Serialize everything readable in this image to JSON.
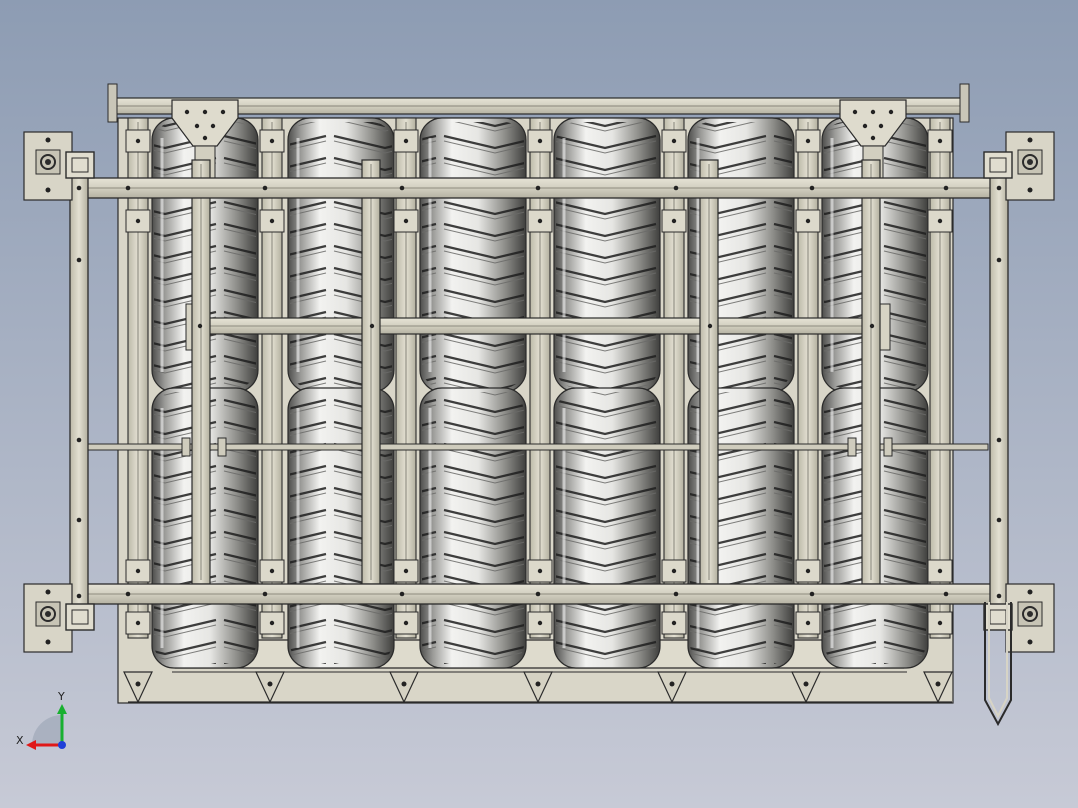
{
  "colors": {
    "background_top": "#8d9cb3",
    "background_bottom": "#c7cad6",
    "metal": "#d7d4c6",
    "metal_shade": "#b9b6a6",
    "edge": "#2b2b2b",
    "tire_light": "#eeeeec",
    "tire_dark": "#5a5a58",
    "axis_x": "#e01818",
    "axis_y": "#18b030",
    "axis_z": "#1f3fd8"
  },
  "icons": {
    "triad": "coordinate-triad-icon"
  },
  "triad": {
    "x_label": "X",
    "y_label": "Y"
  }
}
